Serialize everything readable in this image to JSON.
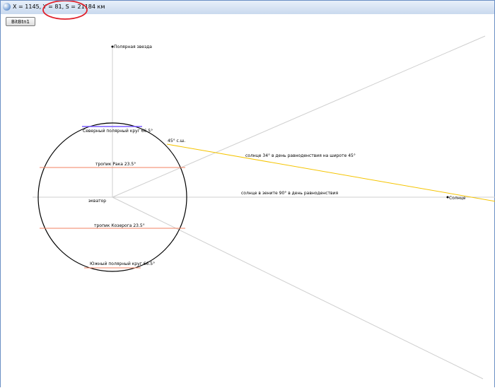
{
  "window": {
    "title": "X = 1145, Y = 81, S = 21184 км"
  },
  "toolbar": {
    "button_label": "BitBtn1"
  },
  "diagram": {
    "polar_star": "Полярная звезда",
    "arctic_circle": "Северный полярный круг  66.5°",
    "tropic_cancer": "тропик Рака 23.5°",
    "equator": "экватор",
    "tropic_capricorn": "тропик Козерога 23.5°",
    "antarctic_circle": "Южный полярный круг  66.5°",
    "latitude_marker": "45° с.ш.",
    "sun_45": "солнце 34° в день равноденствия на широте 45°",
    "sun_zenith": "солнце в зените 90° в день равноденствия",
    "sun": "Солнце"
  },
  "colors": {
    "annotation_circle": "#e0202a",
    "sun_ray": "#f5c400",
    "tropic_line": "#f08060",
    "arctic_line": "#7a5cff",
    "guide_line": "#cfcfcf"
  }
}
